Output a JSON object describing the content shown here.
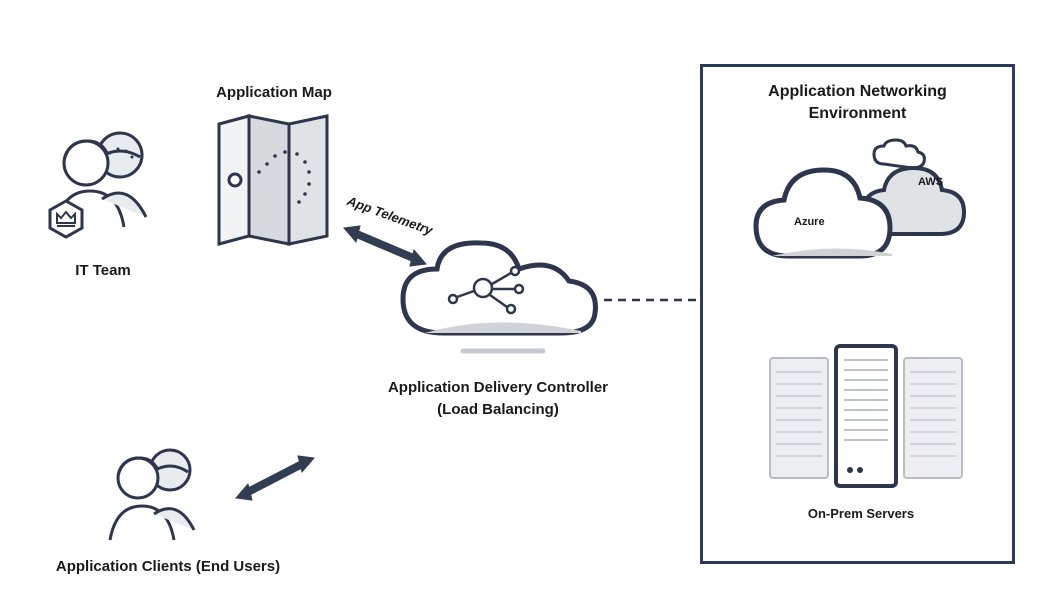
{
  "labels": {
    "it_team": "IT Team",
    "app_map": "Application Map",
    "app_telemetry": "App Telemetry",
    "adc_line1": "Application Delivery Controller",
    "adc_line2": "(Load Balancing)",
    "env_line1": "Application Networking",
    "env_line2": "Environment",
    "clouds_azure": "Azure",
    "clouds_aws": "AWS",
    "onprem": "On-Prem Servers",
    "clients": "Application Clients (End Users)"
  },
  "diagram": {
    "nodes": [
      {
        "id": "it_team",
        "type": "people",
        "label_ref": "it_team"
      },
      {
        "id": "app_map",
        "type": "map",
        "label_ref": "app_map"
      },
      {
        "id": "adc",
        "type": "cloud-controller",
        "label_ref": "adc_line1"
      },
      {
        "id": "clients",
        "type": "people",
        "label_ref": "clients"
      },
      {
        "id": "env",
        "type": "environment-box",
        "label_ref": "env_line1",
        "children": [
          {
            "id": "azure",
            "type": "cloud",
            "label_ref": "clouds_azure"
          },
          {
            "id": "aws",
            "type": "cloud",
            "label_ref": "clouds_aws"
          },
          {
            "id": "onprem",
            "type": "servers",
            "label_ref": "onprem"
          }
        ]
      }
    ],
    "edges": [
      {
        "from": "app_map",
        "to": "adc",
        "style": "double-arrow",
        "label_ref": "app_telemetry"
      },
      {
        "from": "clients",
        "to": "adc",
        "style": "double-arrow"
      },
      {
        "from": "adc",
        "to": "env",
        "style": "dashed-branch"
      }
    ]
  }
}
